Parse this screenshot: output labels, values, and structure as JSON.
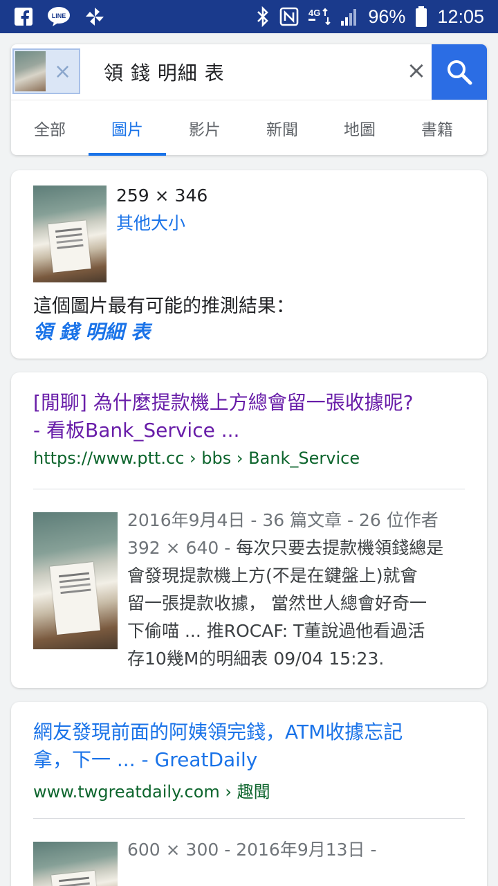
{
  "status_bar": {
    "battery": "96%",
    "time": "12:05",
    "icons": [
      "facebook-icon",
      "line-icon",
      "pinwheel-icon",
      "bluetooth-icon",
      "nfc-icon",
      "4g-icon",
      "signal-icon",
      "battery-icon"
    ]
  },
  "search": {
    "query": "領 錢 明細 表",
    "chip_close": "×",
    "clear": "×"
  },
  "tabs": [
    "全部",
    "圖片",
    "影片",
    "新聞",
    "地圖",
    "書籍"
  ],
  "active_tab": "圖片",
  "image_info": {
    "dimensions": "259 × 346",
    "other_sizes": "其他大小",
    "best_guess_label": "這個圖片最有可能的推測結果：",
    "best_guess_link": "領 錢 明細 表"
  },
  "results": [
    {
      "title_line1": "[閒聊] 為什麼提款機上方總會留一張收據呢?",
      "title_line2": "- 看板Bank_Service ...",
      "url": "https://www.ptt.cc › bbs › Bank_Service",
      "meta": "2016年9月4日 - 36 篇文章 - 26 位作者",
      "snippet_dims": "392 × 640 -",
      "snippet_lines": [
        " 每次只要去提款機領錢總是",
        "會發現提款機上方(不是在鍵盤上)就會",
        "留一張提款收據， 當然世人總會好奇一",
        "下偷喵 ... 推ROCAF: T董說過他看過活",
        "存10幾M的明細表 09/04 15:23."
      ]
    },
    {
      "title_line1": "網友發現前面的阿姨領完錢，ATM收據忘記",
      "title_line2": "拿，下一 ... - GreatDaily",
      "url": "www.twgreatdaily.com › 趣聞",
      "meta": "600 × 300 - 2016年9月13日 -"
    }
  ]
}
